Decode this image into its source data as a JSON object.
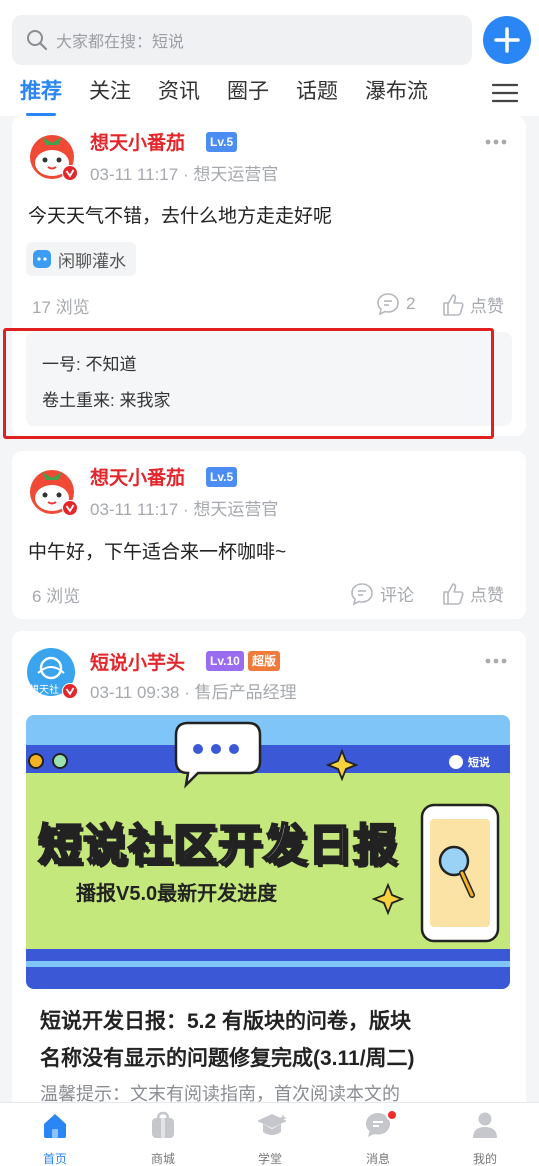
{
  "search": {
    "placeholder": "大家都在搜：短说",
    "icon": "search-icon"
  },
  "tabs": [
    {
      "label": "推荐",
      "active": true
    },
    {
      "label": "关注"
    },
    {
      "label": "资讯"
    },
    {
      "label": "圈子"
    },
    {
      "label": "话题"
    },
    {
      "label": "瀑布流"
    }
  ],
  "colors": {
    "accent": "#2a86f4",
    "name_red": "#e3262c",
    "lv_blue": "#4b8df3",
    "lv_purple": "#9a6cf0",
    "super_orange": "#f07a3a",
    "highlight": "#e02020"
  },
  "posts": [
    {
      "author": "想天小番茄",
      "level": "Lv.5",
      "time": "03-11 11:17 · 想天运营官",
      "content": "今天天气不错，去什么地方走走好呢",
      "topic": "闲聊灌水",
      "views": "17 浏览",
      "comment_count": "2",
      "like_label": "点赞",
      "comments": [
        {
          "text": "一号: 不知道"
        },
        {
          "text": "卷土重来: 来我家"
        }
      ]
    },
    {
      "author": "想天小番茄",
      "level": "Lv.5",
      "time": "03-11 11:17 · 想天运营官",
      "content": "中午好，下午适合来一杯咖啡~",
      "views": "6 浏览",
      "comment_label": "评论",
      "like_label": "点赞"
    },
    {
      "author": "短说小芋头",
      "level": "Lv.10",
      "badge": "超版",
      "time": "03-11 09:38 · 售后产品经理",
      "avatar_text": "想天社",
      "banner": {
        "title": "短说社区开发日报",
        "subtitle": "播报V5.0最新开发进度",
        "logo": "短说"
      },
      "article_title_line1": "短说开发日报：5.2 有版块的问卷，版块",
      "article_title_line2": "名称没有显示的问题修复完成(3.11/周二)",
      "hint": "温馨提示：文末有阅读指南，首次阅读本文的"
    }
  ],
  "bottom_nav": [
    {
      "label": "首页",
      "icon": "home-icon",
      "active": true
    },
    {
      "label": "商城",
      "icon": "shopping-bag-icon"
    },
    {
      "label": "学堂",
      "icon": "graduation-cap-icon"
    },
    {
      "label": "消息",
      "icon": "message-icon",
      "has_dot": true
    },
    {
      "label": "我的",
      "icon": "user-icon"
    }
  ]
}
